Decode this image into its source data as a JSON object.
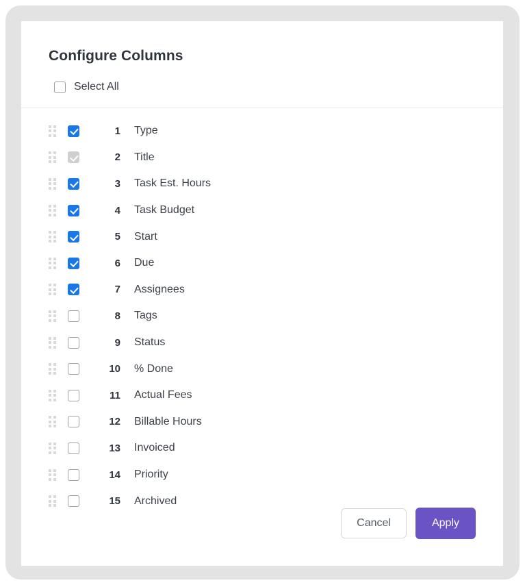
{
  "dialog": {
    "title": "Configure Columns",
    "select_all": {
      "label": "Select All",
      "checked": false,
      "icon": "checkbox-icon"
    },
    "drag_handle_icon": "drag-handle-icon",
    "columns": [
      {
        "index": "1",
        "label": "Type",
        "checked": true,
        "disabled": false
      },
      {
        "index": "2",
        "label": "Title",
        "checked": true,
        "disabled": true
      },
      {
        "index": "3",
        "label": "Task Est. Hours",
        "checked": true,
        "disabled": false
      },
      {
        "index": "4",
        "label": "Task Budget",
        "checked": true,
        "disabled": false
      },
      {
        "index": "5",
        "label": "Start",
        "checked": true,
        "disabled": false
      },
      {
        "index": "6",
        "label": "Due",
        "checked": true,
        "disabled": false
      },
      {
        "index": "7",
        "label": "Assignees",
        "checked": true,
        "disabled": false
      },
      {
        "index": "8",
        "label": "Tags",
        "checked": false,
        "disabled": false
      },
      {
        "index": "9",
        "label": "Status",
        "checked": false,
        "disabled": false
      },
      {
        "index": "10",
        "label": "% Done",
        "checked": false,
        "disabled": false
      },
      {
        "index": "11",
        "label": "Actual Fees",
        "checked": false,
        "disabled": false
      },
      {
        "index": "12",
        "label": "Billable Hours",
        "checked": false,
        "disabled": false
      },
      {
        "index": "13",
        "label": "Invoiced",
        "checked": false,
        "disabled": false
      },
      {
        "index": "14",
        "label": "Priority",
        "checked": false,
        "disabled": false
      },
      {
        "index": "15",
        "label": "Archived",
        "checked": false,
        "disabled": false
      }
    ],
    "footer": {
      "cancel_label": "Cancel",
      "apply_label": "Apply"
    }
  },
  "colors": {
    "checkbox_checked": "#1a77e8",
    "checkbox_disabled": "#cfcfcf",
    "apply_button": "#6a53c4",
    "backdrop": "#e3e3e3",
    "surface": "#ffffff",
    "divider": "#e6e6e6",
    "text_primary": "#30353c",
    "text_secondary": "#3c4148",
    "drag_dot": "#d7d9dc"
  }
}
